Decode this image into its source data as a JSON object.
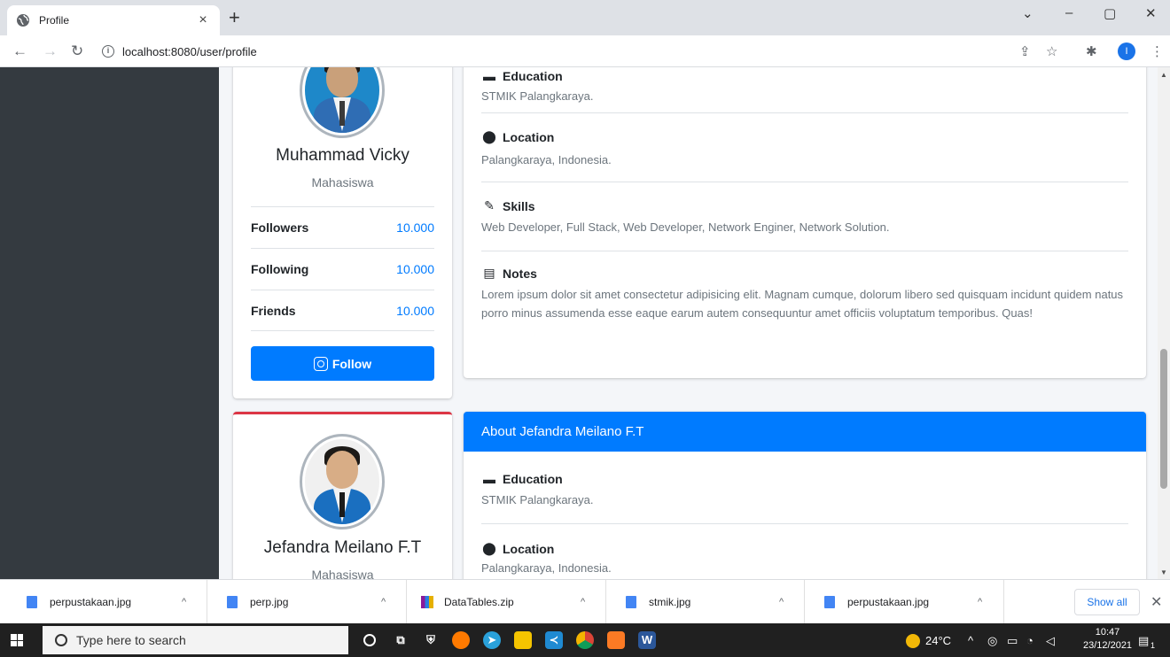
{
  "browser": {
    "tab_title": "Profile",
    "tab_close": "×",
    "new_tab": "+",
    "url": "localhost:8080/user/profile",
    "info_icon": "i",
    "profile_initial": "I",
    "win_minimize": "–",
    "win_maximize": "▢",
    "win_close": "✕",
    "dropdown": "⌄"
  },
  "profiles": [
    {
      "name": "Muhammad Vicky",
      "role": "Mahasiswa",
      "stats": [
        {
          "label": "Followers",
          "value": "10.000"
        },
        {
          "label": "Following",
          "value": "10.000"
        },
        {
          "label": "Friends",
          "value": "10.000"
        }
      ],
      "follow_label": "Follow",
      "about": {
        "sections": [
          {
            "title": "Education",
            "text": "STMIK Palangkaraya."
          },
          {
            "title": "Location",
            "text": "Palangkaraya, Indonesia."
          },
          {
            "title": "Skills",
            "text": "Web Developer, Full Stack, Web Developer, Network Enginer, Network Solution."
          },
          {
            "title": "Notes",
            "text": "Lorem ipsum dolor sit amet consectetur adipisicing elit. Magnam cumque, dolorum libero sed quisquam incidunt quidem natus porro minus assumenda esse eaque earum autem consequuntur amet officiis voluptatum temporibus. Quas!"
          }
        ]
      }
    },
    {
      "name": "Jefandra Meilano F.T",
      "role": "Mahasiswa",
      "about": {
        "header": "About Jefandra Meilano F.T",
        "sections": [
          {
            "title": "Education",
            "text": "STMIK Palangkaraya."
          },
          {
            "title": "Location",
            "text": "Palangkaraya, Indonesia."
          }
        ]
      }
    }
  ],
  "downloads": {
    "items": [
      "perpustakaan.jpg",
      "perp.jpg",
      "DataTables.zip",
      "stmik.jpg",
      "perpustakaan.jpg"
    ],
    "show_all": "Show all",
    "close": "✕",
    "caret": "^"
  },
  "taskbar": {
    "search_placeholder": "Type here to search",
    "weather": "24°C",
    "time": "10:47",
    "date": "23/12/2021",
    "notif_count": "1"
  },
  "colors": {
    "accent": "#007bff",
    "sidebar": "#343a40",
    "card_top_border": "#dc3545"
  }
}
